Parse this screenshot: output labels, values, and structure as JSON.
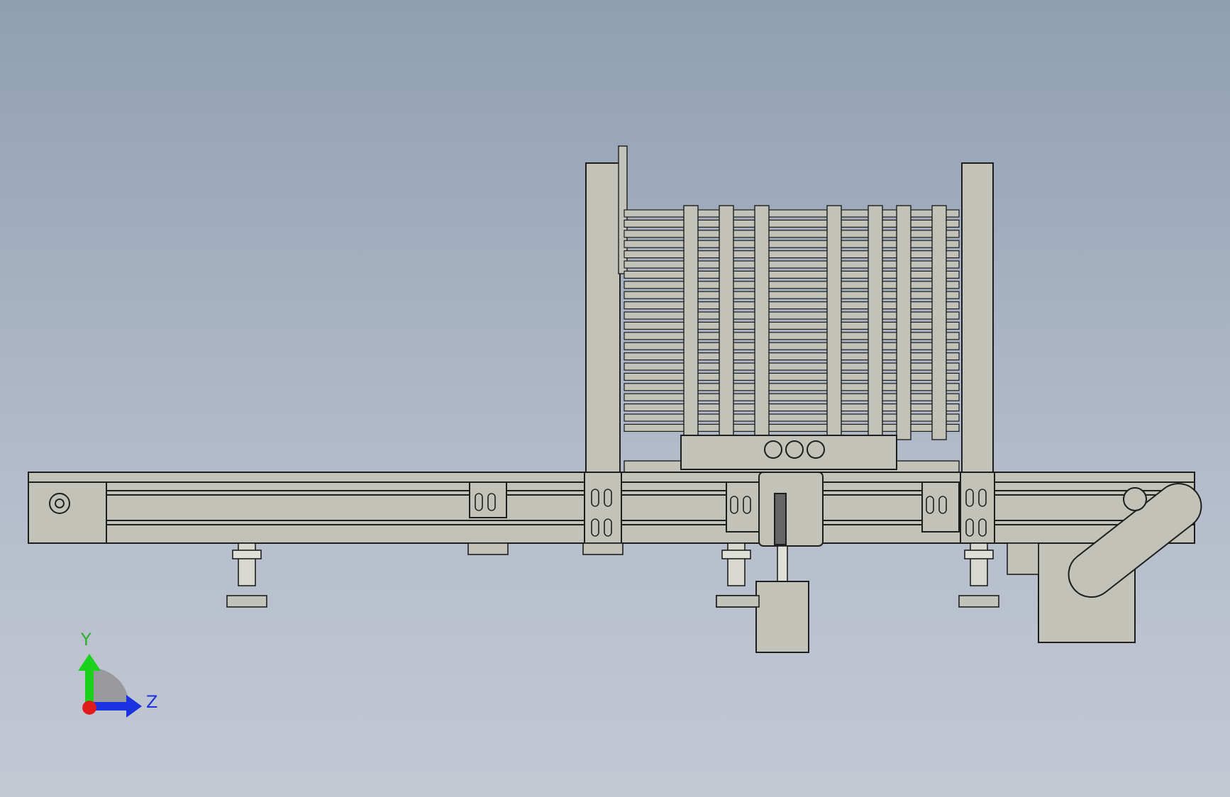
{
  "viewport": {
    "triad": {
      "axes": [
        {
          "label": "Y",
          "kind": "vertical"
        },
        {
          "label": "Z",
          "kind": "horizontal"
        }
      ]
    }
  }
}
